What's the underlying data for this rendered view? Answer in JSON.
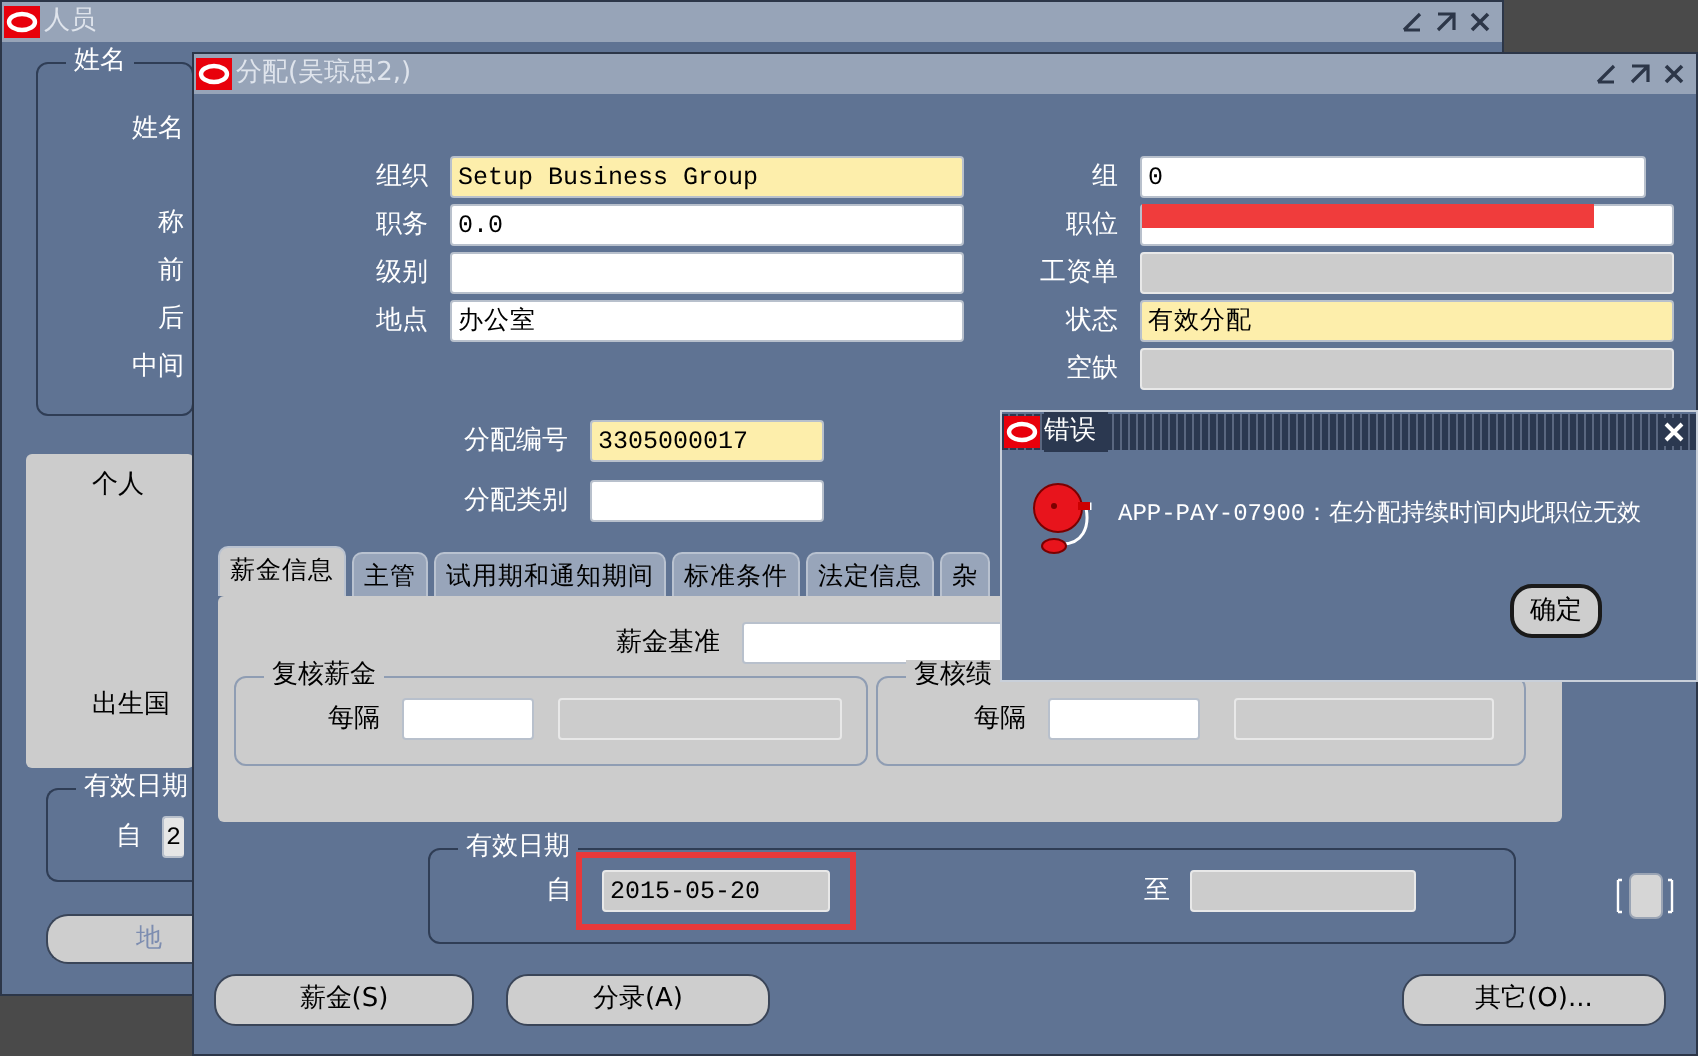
{
  "background_window": {
    "title": "人员",
    "name_group": {
      "title": "姓名",
      "labels": [
        "姓名",
        "称",
        "前",
        "后",
        "中间"
      ]
    },
    "personal_panel": {
      "title": "个人",
      "labels": [
        "出生国"
      ]
    },
    "effective_dates": {
      "title": "有效日期",
      "from_label": "自",
      "from_value": "2"
    },
    "buttons": [
      {
        "label": "地",
        "disabled": true
      }
    ]
  },
  "assignment_window": {
    "title": "分配(吴琼思2,)",
    "left_fields": [
      {
        "label": "组织",
        "value": "Setup Business Group",
        "kind": "required"
      },
      {
        "label": "职务",
        "value": "0.0",
        "kind": "text"
      },
      {
        "label": "级别",
        "kind": "text"
      },
      {
        "label": "地点",
        "value": "办公室",
        "kind": "text"
      }
    ],
    "right_fields": [
      {
        "label": "组",
        "value": "0",
        "kind": "text"
      },
      {
        "label": "职位",
        "kind": "text",
        "redacted": true
      },
      {
        "label": "工资单",
        "kind": "readonly"
      },
      {
        "label": "状态",
        "value": "有效分配",
        "kind": "required"
      },
      {
        "label": "空缺",
        "kind": "readonly"
      }
    ],
    "number_fields": [
      {
        "label": "分配编号",
        "value": "3305000017",
        "kind": "required"
      },
      {
        "label": "分配类别",
        "kind": "text"
      }
    ],
    "tabs": [
      {
        "label": "薪金信息",
        "selected": true
      },
      {
        "label": "主管",
        "selected": false
      },
      {
        "label": "试用期和通知期间",
        "selected": false
      },
      {
        "label": "标准条件",
        "selected": false
      },
      {
        "label": "法定信息",
        "selected": false
      },
      {
        "label": "杂",
        "selected": false
      }
    ],
    "salary_basis": {
      "label": "薪金基准"
    },
    "review_groups": [
      {
        "title": "复核薪金",
        "label": "每隔"
      },
      {
        "title": "复核绩",
        "label": "每隔"
      }
    ],
    "effective_dates": {
      "title": "有效日期",
      "from_label": "自",
      "from_value": "2015-05-20",
      "from_highlighted": true,
      "to_label": "至"
    },
    "buttons": [
      {
        "label": "薪金(S)"
      },
      {
        "label": "分录(A)"
      },
      {
        "label": "其它(O)..."
      }
    ]
  },
  "error_dialog": {
    "title": "错误",
    "message": "APP-PAY-07900：在分配持续时间内此职位无效",
    "button": "确定"
  }
}
